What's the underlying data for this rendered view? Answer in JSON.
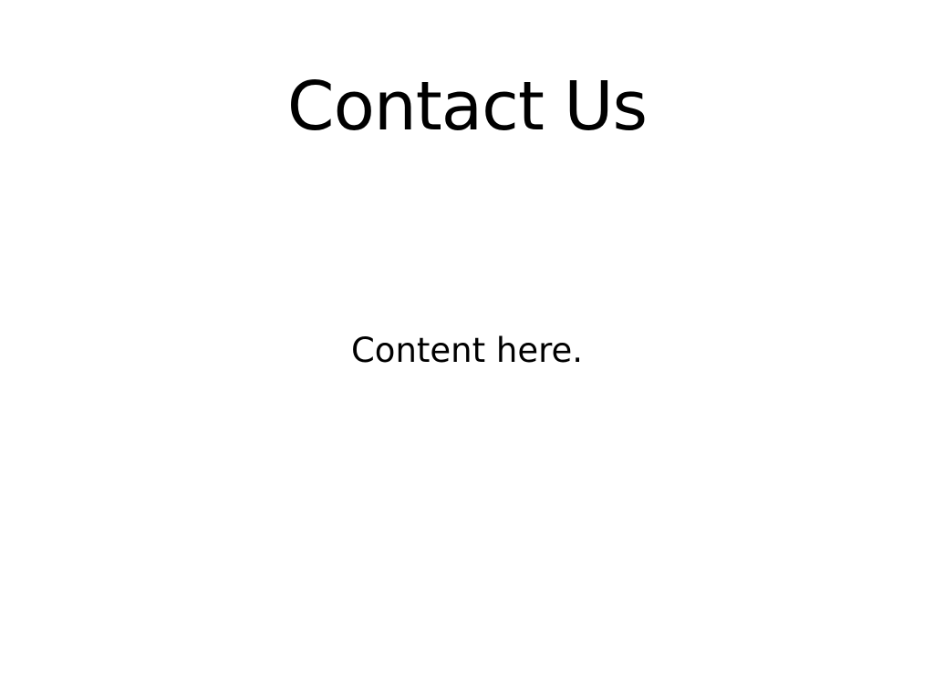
{
  "page": {
    "title": "Contact Us",
    "content": "Content here."
  },
  "colors": {
    "background": "#ffffff",
    "text": "#000000"
  }
}
